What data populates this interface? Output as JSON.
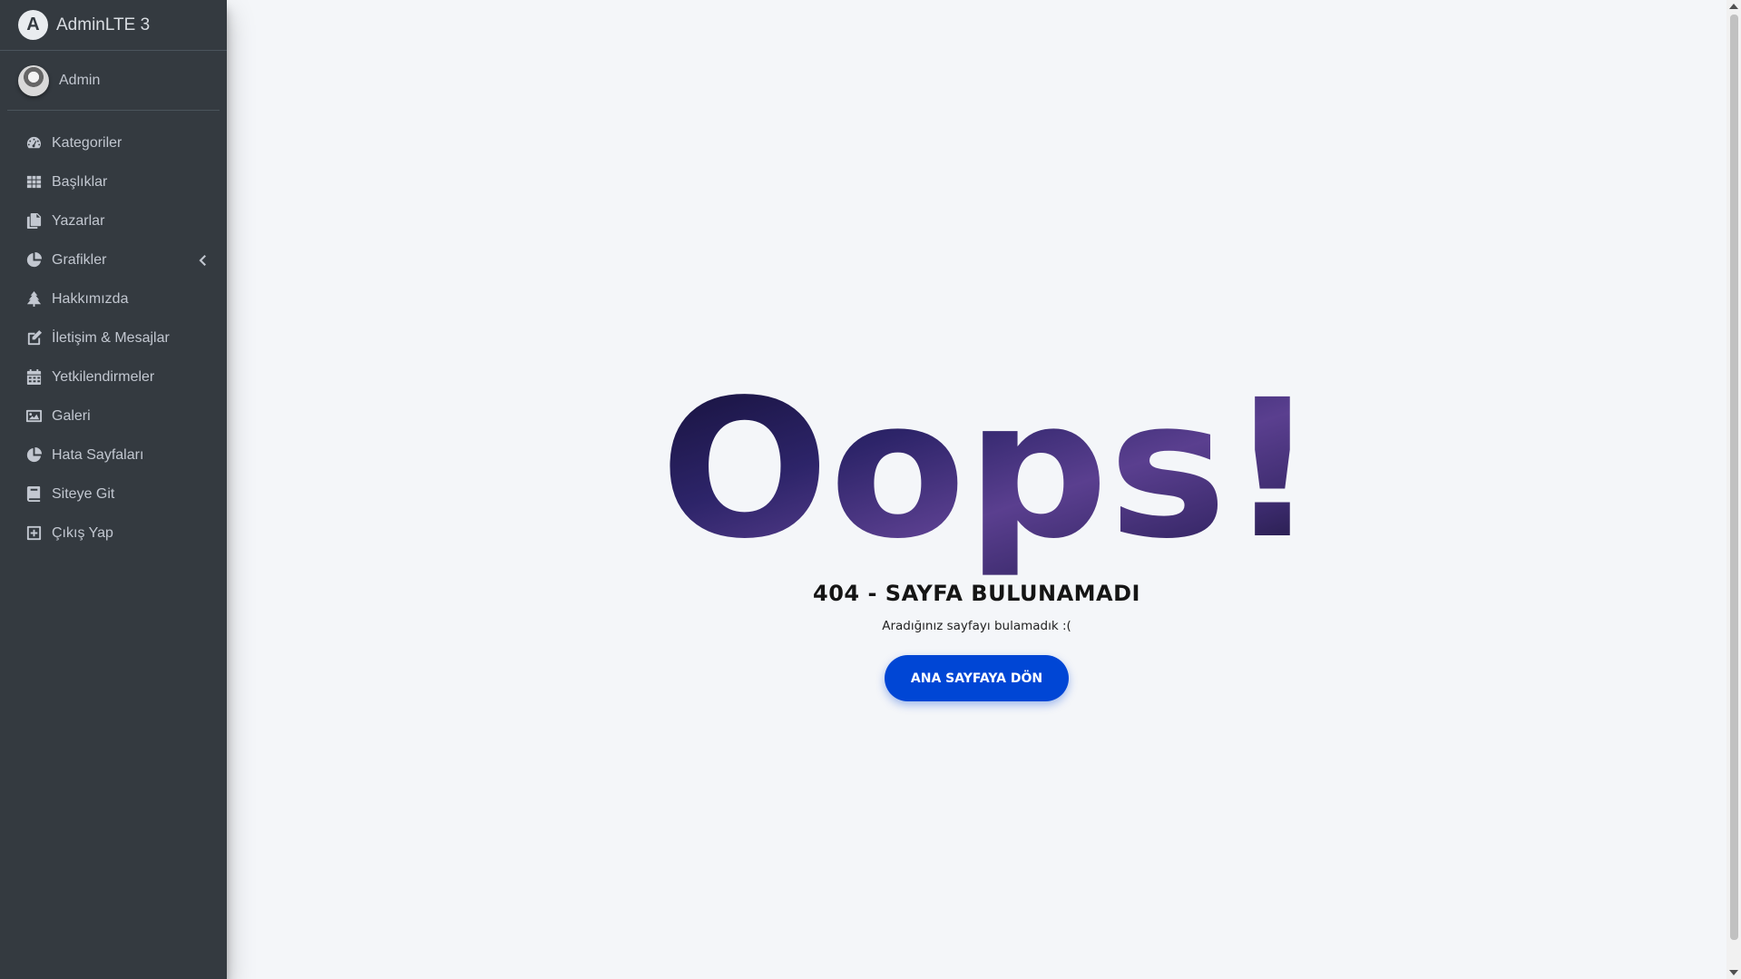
{
  "brand": {
    "logo_letter": "A",
    "title": "AdminLTE 3"
  },
  "user": {
    "name": "Admin"
  },
  "sidebar": {
    "items": [
      {
        "label": "Kategoriler",
        "icon": "tachometer-icon"
      },
      {
        "label": "Başlıklar",
        "icon": "grid-icon"
      },
      {
        "label": "Yazarlar",
        "icon": "copy-icon"
      },
      {
        "label": "Grafikler",
        "icon": "pie-chart-icon",
        "has_submenu": true
      },
      {
        "label": "Hakkımızda",
        "icon": "tree-icon"
      },
      {
        "label": "İletişim & Mesajlar",
        "icon": "edit-icon"
      },
      {
        "label": "Yetkilendirmeler",
        "icon": "calendar-icon"
      },
      {
        "label": "Galeri",
        "icon": "image-icon"
      },
      {
        "label": "Hata Sayfaları",
        "icon": "pie-chart-icon"
      },
      {
        "label": "Siteye Git",
        "icon": "book-icon"
      },
      {
        "label": "Çıkış Yap",
        "icon": "plus-square-icon"
      }
    ]
  },
  "error": {
    "headline": "Oops!",
    "title": "404 - SAYFA BULUNAMADI",
    "subtitle": "Aradığınız sayfayı bulamadık :(",
    "button_label": "ANA SAYFAYA DÖN"
  },
  "colors": {
    "sidebar_bg": "#343a40",
    "content_bg": "#f4f6f9",
    "button_bg": "#0046d5",
    "headline_fill_dark": "#1a1540",
    "headline_fill_light": "#5a3f8f"
  }
}
